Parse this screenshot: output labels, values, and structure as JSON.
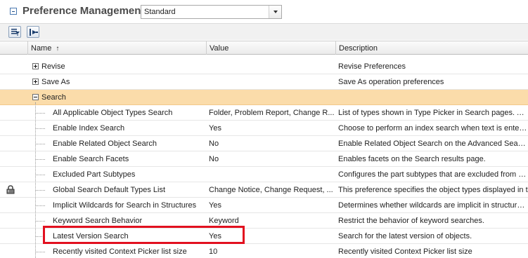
{
  "header": {
    "title": "Preference Management",
    "view_selected": "Standard"
  },
  "columns": {
    "name": "Name",
    "name_sort_indicator": "↑",
    "value": "Value",
    "description": "Description"
  },
  "rows": [
    {
      "type": "group",
      "expand": "plus",
      "name": "Revise",
      "value": "",
      "description": "Revise Preferences"
    },
    {
      "type": "group",
      "expand": "plus",
      "name": "Save As",
      "value": "",
      "description": "Save As operation preferences"
    },
    {
      "type": "group",
      "expand": "minus",
      "name": "Search",
      "value": "",
      "description": "",
      "selected": true
    },
    {
      "type": "child",
      "name": "All Applicable Object Types Search",
      "value": "Folder, Problem Report, Change R...",
      "description": "List of types shown in Type Picker in Search pages. Also"
    },
    {
      "type": "child",
      "name": "Enable Index Search",
      "value": "Yes",
      "description": "Choose to perform an index search when text is entered"
    },
    {
      "type": "child",
      "name": "Enable Related Object Search",
      "value": "No",
      "description": "Enable Related Object Search on the Advanced Search"
    },
    {
      "type": "child",
      "name": "Enable Search Facets",
      "value": "No",
      "description": "Enables facets on the Search results page."
    },
    {
      "type": "child",
      "name": "Excluded Part Subtypes",
      "value": "",
      "description": "Configures the part subtypes that are excluded from sea"
    },
    {
      "type": "child",
      "name": "Global Search Default Types List",
      "value": "Change Notice, Change Request, ...",
      "description": "This preference specifies the object types displayed in t",
      "locked": true
    },
    {
      "type": "child",
      "name": "Implicit Wildcards for Search in Structures",
      "value": "Yes",
      "description": "Determines whether wildcards are implicit in structure-re"
    },
    {
      "type": "child",
      "name": "Keyword Search Behavior",
      "value": "Keyword",
      "description": "Restrict the behavior of keyword searches."
    },
    {
      "type": "child",
      "name": "Latest Version Search",
      "value": "Yes",
      "description": "Search for the latest version of objects."
    },
    {
      "type": "child",
      "name": "Recently visited Context Picker list size",
      "value": "10",
      "description": "Recently visited Context Picker list size"
    }
  ],
  "colors": {
    "selected_row": "#fbdcaa",
    "highlight_border": "#e2101f"
  }
}
